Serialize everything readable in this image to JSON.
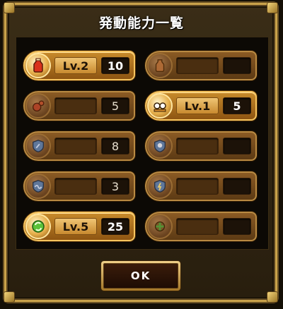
{
  "dialog": {
    "title": "発動能力一覧",
    "ok_label": "OK"
  },
  "abilities": [
    {
      "id": "a1",
      "active": true,
      "level_label": "Lv.2",
      "count": "10",
      "icon": "potion-icon"
    },
    {
      "id": "a2",
      "active": false,
      "level_label": "",
      "count": "",
      "icon": "potion-icon"
    },
    {
      "id": "a3",
      "active": false,
      "level_label": "",
      "count": "5",
      "icon": "bomb-icon"
    },
    {
      "id": "a4",
      "active": true,
      "level_label": "Lv.1",
      "count": "5",
      "icon": "goggle-icon"
    },
    {
      "id": "a5",
      "active": false,
      "level_label": "",
      "count": "8",
      "icon": "shield-icon"
    },
    {
      "id": "a6",
      "active": false,
      "level_label": "",
      "count": "",
      "icon": "shield-skull-icon"
    },
    {
      "id": "a7",
      "active": false,
      "level_label": "",
      "count": "3",
      "icon": "shield-wave-icon"
    },
    {
      "id": "a8",
      "active": false,
      "level_label": "",
      "count": "",
      "icon": "shield-bolt-icon"
    },
    {
      "id": "a9",
      "active": true,
      "level_label": "Lv.5",
      "count": "25",
      "icon": "recycle-icon"
    },
    {
      "id": "a10",
      "active": false,
      "level_label": "",
      "count": "",
      "icon": "gear-cross-icon"
    }
  ],
  "colors": {
    "active_gold": "#f6c45e",
    "inactive_brown": "#8a5a24",
    "frame_gold": "#c9a24a"
  }
}
